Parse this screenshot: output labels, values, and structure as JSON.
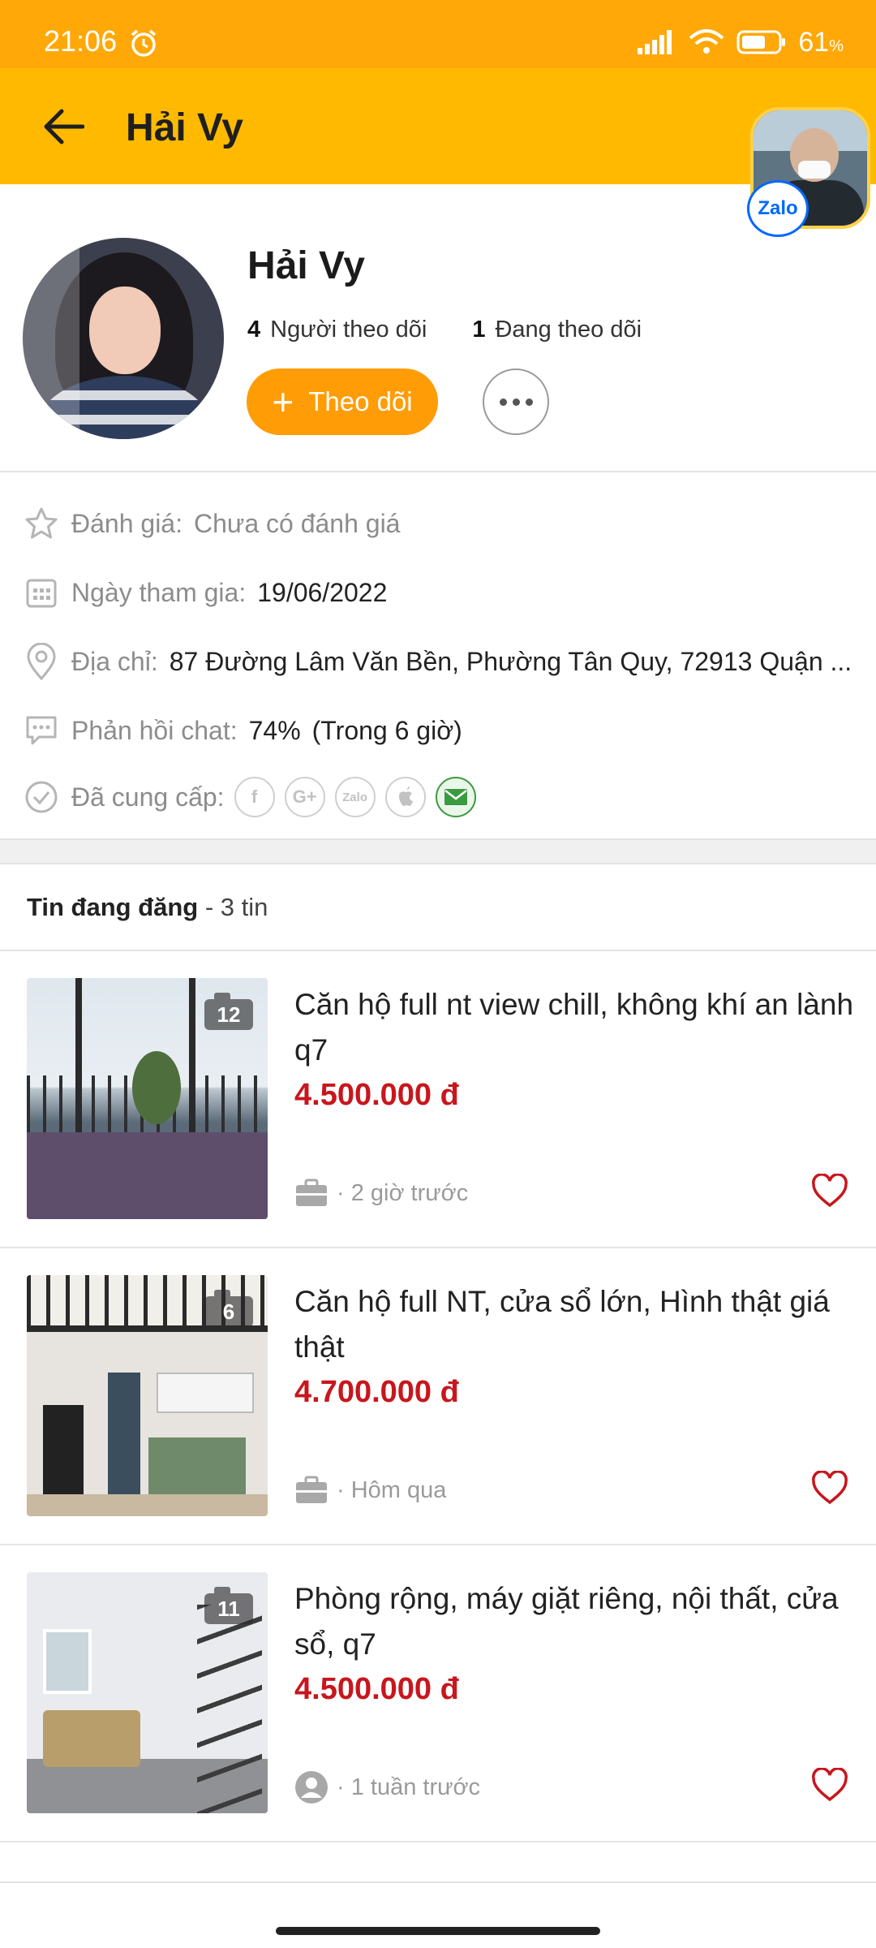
{
  "status_bar": {
    "time": "21:06",
    "battery": "61",
    "battery_unit": "%"
  },
  "app_bar": {
    "title": "Hải Vy"
  },
  "zalo": {
    "label": "Zalo"
  },
  "profile": {
    "name": "Hải Vy",
    "followers_count": "4",
    "followers_label": "Người theo dõi",
    "following_count": "1",
    "following_label": "Đang theo dõi",
    "follow_button": "Theo dõi"
  },
  "info": {
    "rating_label": "Đánh giá:",
    "rating_value": "Chưa có đánh giá",
    "joined_label": "Ngày tham gia:",
    "joined_value": "19/06/2022",
    "address_label": "Địa chỉ:",
    "address_value": "87 Đường Lâm Văn Bền, Phường Tân Quy, 72913 Quận ...",
    "chat_label": "Phản hồi chat:",
    "chat_value": "74%",
    "chat_time": "(Trong 6 giờ)",
    "provided_label": "Đã cung cấp:",
    "providers": [
      "facebook-icon",
      "google-plus-icon",
      "zalo-icon",
      "apple-icon",
      "email-icon"
    ],
    "provider_zalo_text": "Zalo"
  },
  "listings_section": {
    "title": "Tin đang đăng",
    "count_text": "- 3 tin"
  },
  "listings": [
    {
      "title": "Căn hộ full nt view chill, không khí an lành q7",
      "price": "4.500.000 đ",
      "photos": "12",
      "time": "2 giờ trước",
      "poster_icon": "briefcase-icon"
    },
    {
      "title": "Căn hộ full NT, cửa sổ lớn, Hình thật giá thật",
      "price": "4.700.000 đ",
      "photos": "6",
      "time": "Hôm qua",
      "poster_icon": "briefcase-icon"
    },
    {
      "title": "Phòng rộng, máy giặt riêng, nội thất, cửa sổ, q7",
      "price": "4.500.000 đ",
      "photos": "11",
      "time": "1 tuần trước",
      "poster_icon": "person-icon"
    }
  ],
  "colors": {
    "accent": "#ffba00",
    "status_bar": "#ffa808",
    "follow_button": "#ff9c06",
    "price": "#c8161d"
  }
}
